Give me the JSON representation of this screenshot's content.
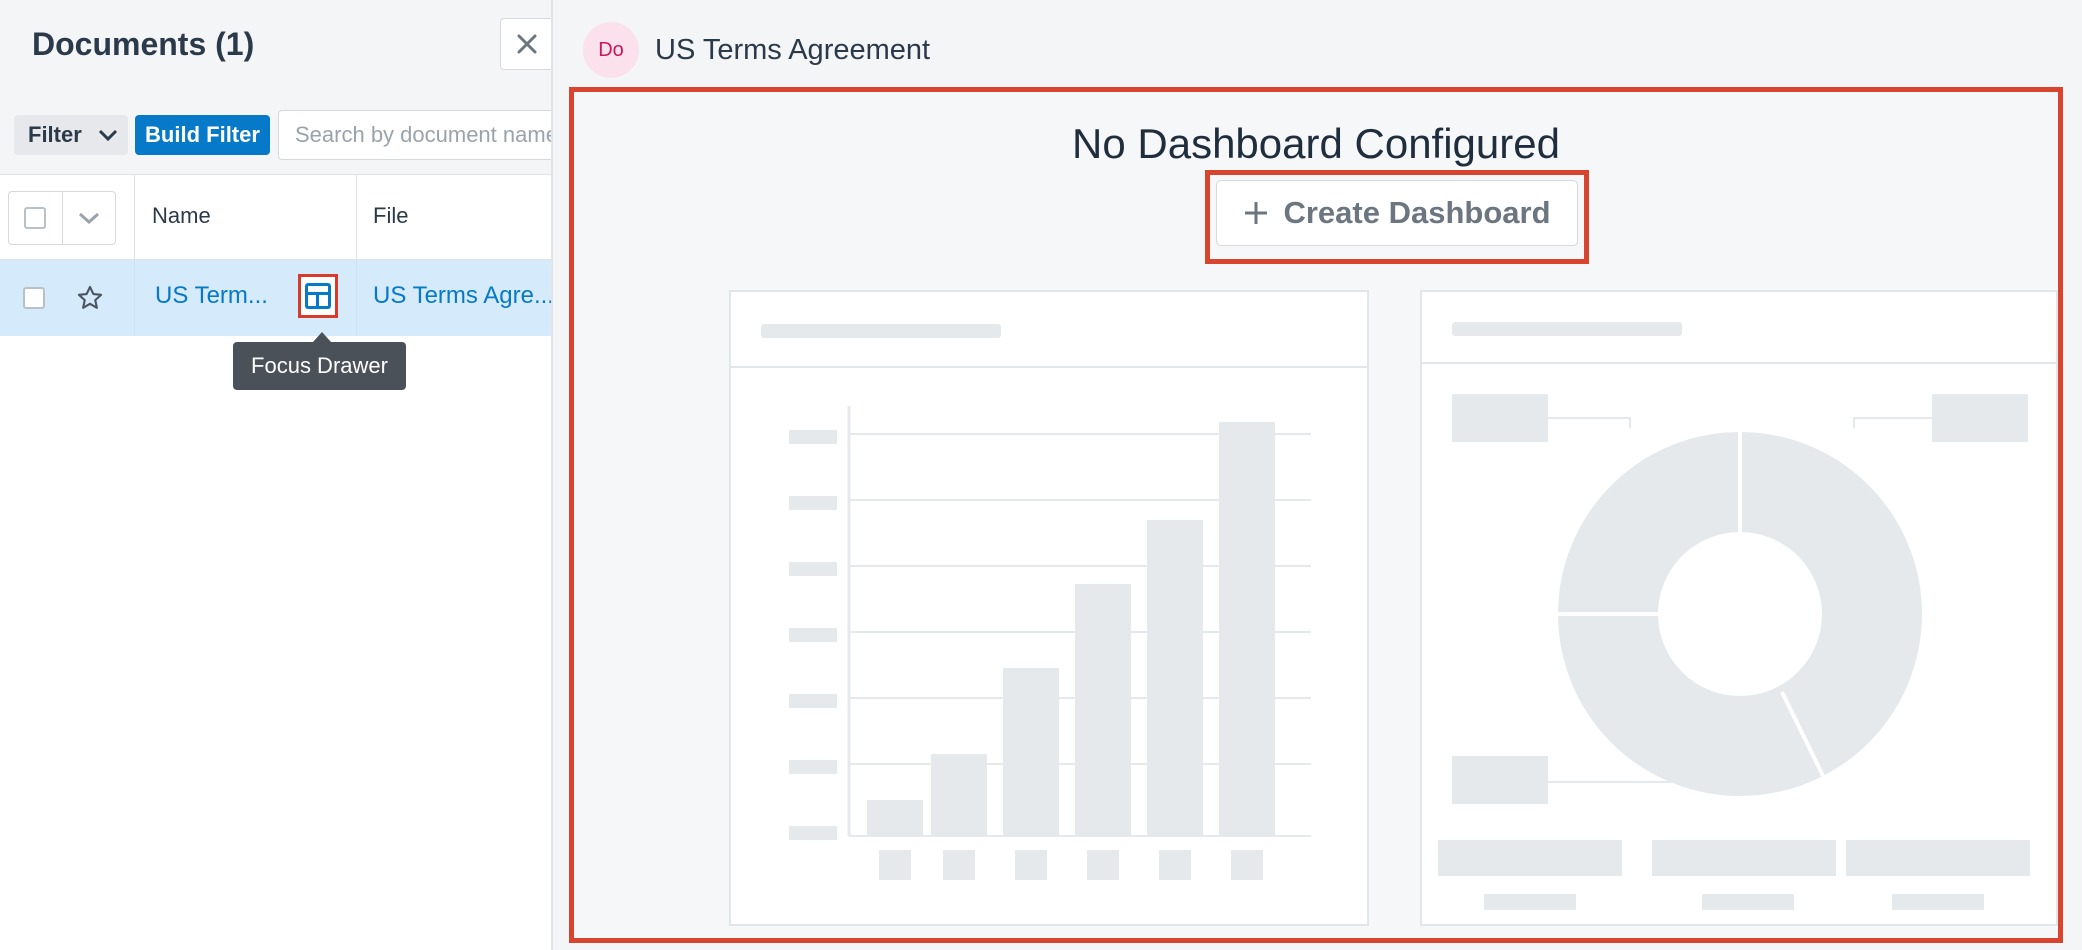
{
  "left_panel": {
    "title": "Documents (1)",
    "close_icon": "close-icon",
    "filter": {
      "dropdown_label": "Filter",
      "build_filter_label": "Build Filter",
      "search_placeholder": "Search by document name..."
    },
    "table": {
      "columns": [
        "Name",
        "File"
      ],
      "rows": [
        {
          "name": "US Term...",
          "file": "US Terms Agre..."
        }
      ]
    },
    "tooltip": "Focus Drawer"
  },
  "right_panel": {
    "avatar_initials": "Do",
    "record_title": "US Terms Agreement",
    "dashboard": {
      "heading": "No Dashboard Configured",
      "create_button_label": "Create Dashboard"
    }
  },
  "colors": {
    "accent": "#0679c8",
    "highlight_outline": "#d9442f",
    "row_selected": "#d5eafa",
    "placeholder": "#e6e9ec"
  }
}
